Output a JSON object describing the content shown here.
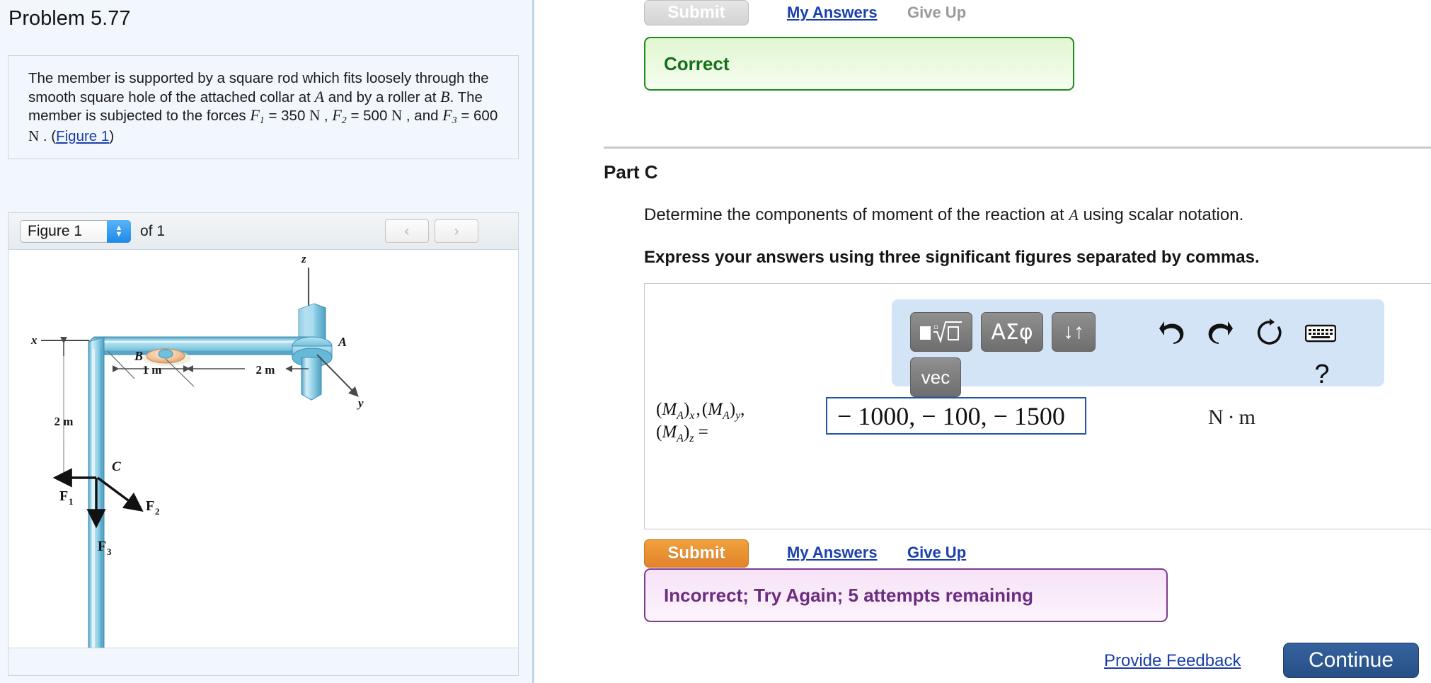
{
  "problem": {
    "title": "Problem 5.77",
    "statement_lines": [
      "The member is supported by a square rod which fits",
      "loosely through the smooth square hole of the attached",
      "collar at A and by a roller at B. The member is",
      "subjected to the forces F1 = 350 N , F2 = 500 N , and",
      "F3 = 600 N . (Figure 1)"
    ],
    "statement_parts": {
      "s1": "The member is supported by a square rod which fits loosely through the smooth square hole of the attached collar at ",
      "varA": "A",
      "s2": " and by a roller at ",
      "varB": "B",
      "s3": ". The member is subjected to the forces ",
      "varF1": "F",
      "sub1": "1",
      "eq1": " = 350 ",
      "unitN1": "N",
      "s4": " , ",
      "varF2": "F",
      "sub2": "2",
      "eq2": " = 500 ",
      "unitN2": "N",
      "s5": " , and ",
      "varF3": "F",
      "sub3": "3",
      "eq3": " = 600 ",
      "unitN3": "N",
      "s6": " . (",
      "figure_link": "Figure 1",
      "s7": ")"
    }
  },
  "figure": {
    "selected": "Figure 1",
    "of_label": "of 1",
    "prev_icon": "‹",
    "next_icon": "›",
    "stepper_up": "▲",
    "stepper_down": "▼",
    "labels": {
      "axis_z": "z",
      "axis_x": "x",
      "axis_y": "y",
      "point_A": "A",
      "point_B": "B",
      "point_C": "C",
      "dim_1m": "1 m",
      "dim_2m_horizontal": "2 m",
      "dim_2m_vertical": "2 m",
      "force_F1": "F",
      "force_F1_sub": "1",
      "force_F2": "F",
      "force_F2_sub": "2",
      "force_F3": "F",
      "force_F3_sub": "3"
    },
    "colors": {
      "member_fill": "#7fc2dc",
      "member_light": "#d6eef7",
      "member_dark": "#3d93b8",
      "collar": "#8fd0e6",
      "roller": "#f0c9a3"
    }
  },
  "previous_part": {
    "submit_label": "Submit",
    "my_answers_label": "My Answers",
    "give_up_label": "Give Up",
    "feedback": "Correct"
  },
  "part_c": {
    "title": "Part C",
    "question_pre": "Determine the components of moment of the reaction at ",
    "question_var": "A",
    "question_post": " using scalar notation.",
    "instruction": "Express your answers using three significant figures separated by commas.",
    "math_toolbar": {
      "fraction_sqrt_button": "fraction-sqrt",
      "greek_button": "ΑΣφ",
      "updown_button": "↓↑",
      "vec_button": "vec",
      "undo_icon": "↶",
      "redo_icon": "↷",
      "reset_icon": "↺",
      "keyboard_icon": "keyboard",
      "help_icon": "?"
    },
    "answer": {
      "label_line1_pre": "(M",
      "label_A": "A",
      "label_line1": "(MA)x , (MA)y ,",
      "label_line2": "(MA)z =",
      "value": "− 1000, − 100, − 1500",
      "units": "N·m"
    },
    "submit_label": "Submit",
    "my_answers_label": "My Answers",
    "give_up_label": "Give Up",
    "feedback": "Incorrect; Try Again; 5 attempts remaining"
  },
  "footer": {
    "provide_feedback": "Provide Feedback",
    "continue_label": "Continue"
  },
  "colors": {
    "accent_blue": "#1a3faa",
    "correct_green": "#14701a",
    "incorrect_purple": "#6b2d80",
    "submit_orange": "#e2822a",
    "continue_blue": "#274f86",
    "panel_bg": "#f2f7fd"
  }
}
